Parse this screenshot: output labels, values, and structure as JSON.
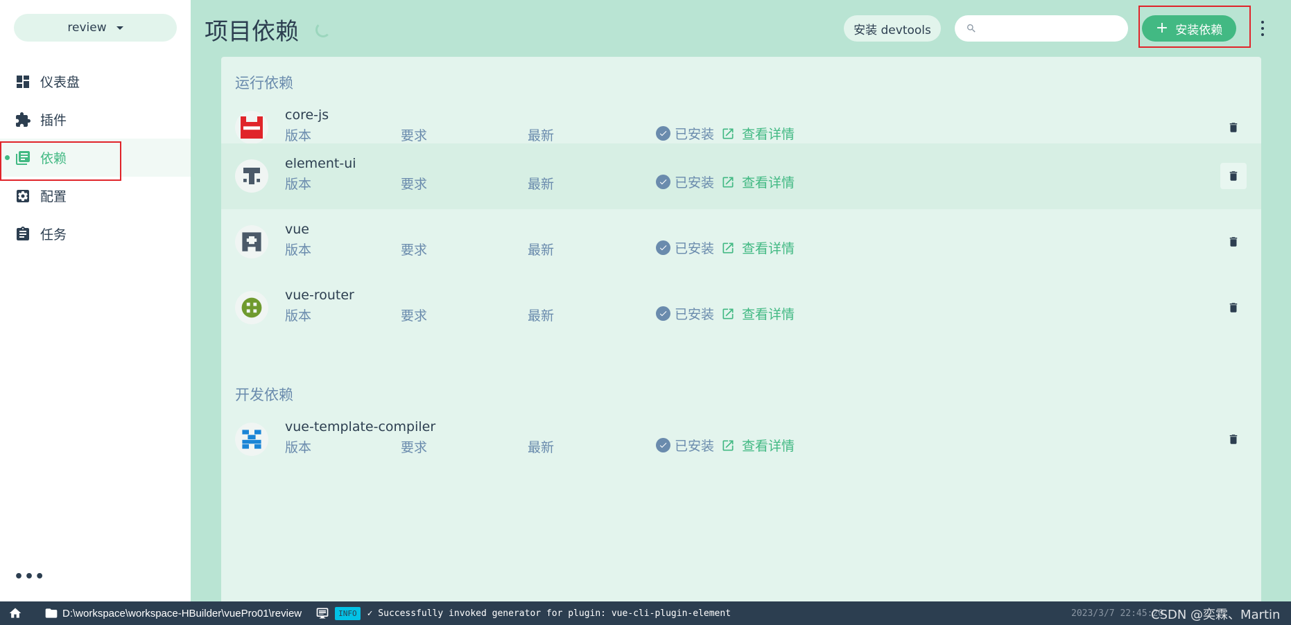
{
  "sidebar": {
    "project": "review",
    "items": [
      {
        "label": "仪表盘",
        "icon": "dashboard-icon"
      },
      {
        "label": "插件",
        "icon": "puzzle-icon"
      },
      {
        "label": "依赖",
        "icon": "library-icon"
      },
      {
        "label": "配置",
        "icon": "gear-icon"
      },
      {
        "label": "任务",
        "icon": "clipboard-icon"
      }
    ],
    "active_index": 2,
    "more": "•••"
  },
  "header": {
    "title": "项目依赖",
    "devtools_label": "安装 devtools",
    "search_value": "",
    "install_label": "安装依赖"
  },
  "sections": {
    "runtime_title": "运行依赖",
    "dev_title": "开发依赖"
  },
  "dependency_labels": {
    "version": "版本",
    "wanted": "要求",
    "latest": "最新",
    "installed": "已安装",
    "details": "查看详情"
  },
  "dependencies": [
    {
      "name": "core-js",
      "section": "runtime",
      "logo_color": "#e0242a"
    },
    {
      "name": "element-ui",
      "section": "runtime",
      "logo_color": "#4a5968"
    },
    {
      "name": "vue",
      "section": "runtime",
      "logo_color": "#4a5968"
    },
    {
      "name": "vue-router",
      "section": "runtime",
      "logo_color": "#6f9a2e"
    },
    {
      "name": "vue-template-compiler",
      "section": "dev",
      "logo_color": "#1a85d6"
    }
  ],
  "statusbar": {
    "path": "D:\\workspace\\workspace-HBuilder\\vuePro01\\review",
    "level": "INFO",
    "message": "✓ Successfully invoked generator for plugin: vue-cli-plugin-element",
    "time": "2023/3/7 22:45:20",
    "watermark": "CSDN @奕霖、Martin"
  },
  "colors": {
    "accent": "#42b983",
    "dark": "#2c3e50",
    "muted": "#6a8bad",
    "background": "#b9e4d3",
    "panel": "#e3f4ed",
    "highlight_border": "#e0242a"
  }
}
